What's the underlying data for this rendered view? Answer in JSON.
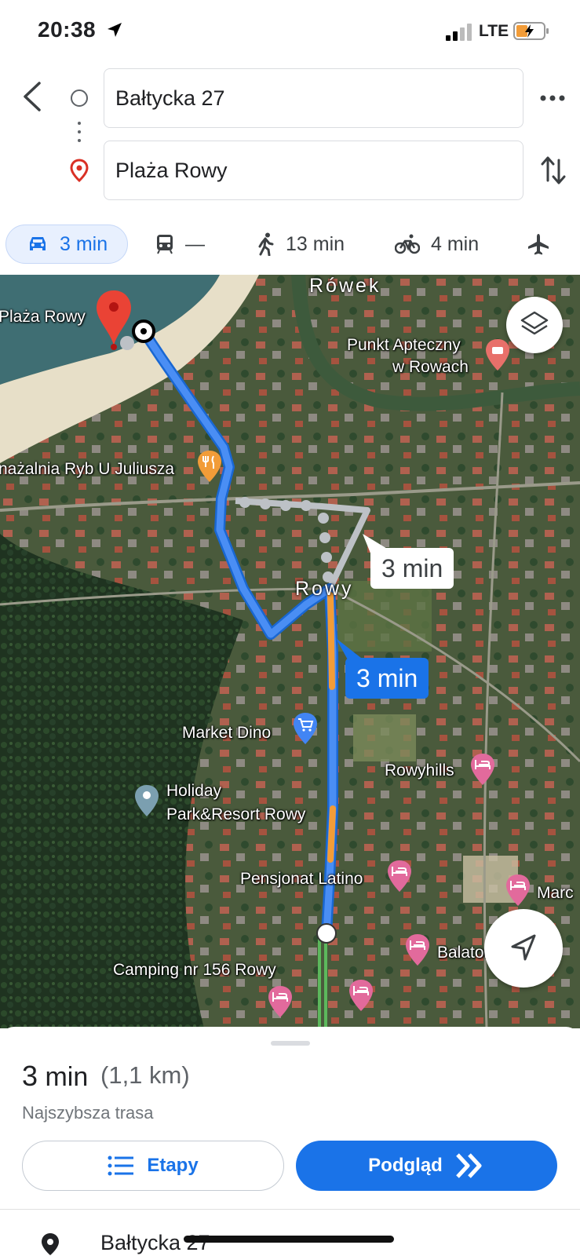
{
  "status_bar": {
    "time": "20:38",
    "network": "LTE"
  },
  "route": {
    "origin_value": "Bałtycka 27",
    "destination_value": "Plaża Rowy"
  },
  "travel_modes": [
    {
      "mode": "car",
      "label": "3 min",
      "icon": "car-icon",
      "active": true
    },
    {
      "mode": "transit",
      "label": "—",
      "icon": "train-icon"
    },
    {
      "mode": "walk",
      "label": "13 min",
      "icon": "walk-icon"
    },
    {
      "mode": "bike",
      "label": "4 min",
      "icon": "bike-icon"
    },
    {
      "mode": "flight",
      "label": "",
      "icon": "plane-icon"
    }
  ],
  "map": {
    "labels": {
      "town_rowek": "Rówek",
      "town_rowy": "Rowy",
      "beach": "Plaża Rowy",
      "pharmacy_line1": "Punkt Apteczny",
      "pharmacy_line2": "w Rowach",
      "smokehouse": "nażalnia Ryb U Juliusza",
      "market": "Market Dino",
      "rowyhills": "Rowyhills",
      "holiday_line1": "Holiday",
      "holiday_line2": "Park&Resort Rowy",
      "pensjonat": "Pensjonat Latino",
      "marc": "Marc",
      "balaton": "Balaton Rowy",
      "camping": "Camping nr 156 Rowy"
    },
    "alt_route_time": "3 min",
    "main_route_time": "3 min",
    "colors": {
      "route_blue": "#4285f4",
      "traffic_orange": "#f29c38",
      "alt_route_gray": "#bdc1c6"
    }
  },
  "sheet": {
    "duration_value": "3",
    "duration_unit": "min",
    "distance": "(1,1 km)",
    "description": "Najszybsza trasa",
    "steps_label": "Etapy",
    "preview_label": "Podgląd",
    "first_step": "Bałtycka 27"
  }
}
